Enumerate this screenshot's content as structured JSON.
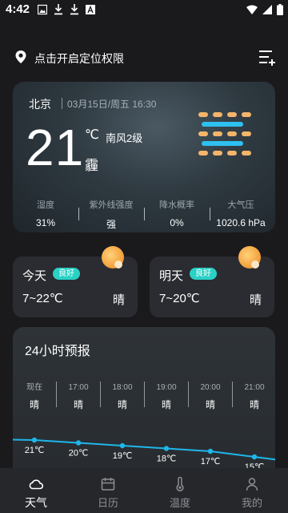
{
  "status_bar": {
    "time": "4:42"
  },
  "location": {
    "prompt": "点击开启定位权限"
  },
  "current": {
    "city": "北京",
    "datetime": "03月15日/周五 16:30",
    "temperature": "21",
    "unit": "℃",
    "wind": "南风2级",
    "condition": "霾",
    "stats": [
      {
        "label": "湿度",
        "value": "31%"
      },
      {
        "label": "紫外线强度",
        "value": "强"
      },
      {
        "label": "降水概率",
        "value": "0%"
      },
      {
        "label": "大气压",
        "value": "1020.6 hPa"
      }
    ]
  },
  "days": {
    "today": {
      "title": "今天",
      "aqi": "良好",
      "range": "7~22℃",
      "condition": "晴"
    },
    "tomorrow": {
      "title": "明天",
      "aqi": "良好",
      "range": "7~20℃",
      "condition": "晴"
    }
  },
  "hourly": {
    "title": "24小时预报",
    "items": [
      {
        "time": "现在",
        "condition": "晴",
        "temp": 21,
        "temp_label": "21℃"
      },
      {
        "time": "17:00",
        "condition": "晴",
        "temp": 20,
        "temp_label": "20℃"
      },
      {
        "time": "18:00",
        "condition": "晴",
        "temp": 19,
        "temp_label": "19℃"
      },
      {
        "time": "19:00",
        "condition": "晴",
        "temp": 18,
        "temp_label": "18℃"
      },
      {
        "time": "20:00",
        "condition": "晴",
        "temp": 17,
        "temp_label": "17℃"
      },
      {
        "time": "21:00",
        "condition": "晴",
        "temp": 15,
        "temp_label": "15℃"
      }
    ]
  },
  "nav": {
    "weather": "天气",
    "calendar": "日历",
    "temperature": "温度",
    "mine": "我的"
  },
  "colors": {
    "accent": "#2ad1c5",
    "curve": "#1fb6ea",
    "sun": "#f7a641"
  }
}
